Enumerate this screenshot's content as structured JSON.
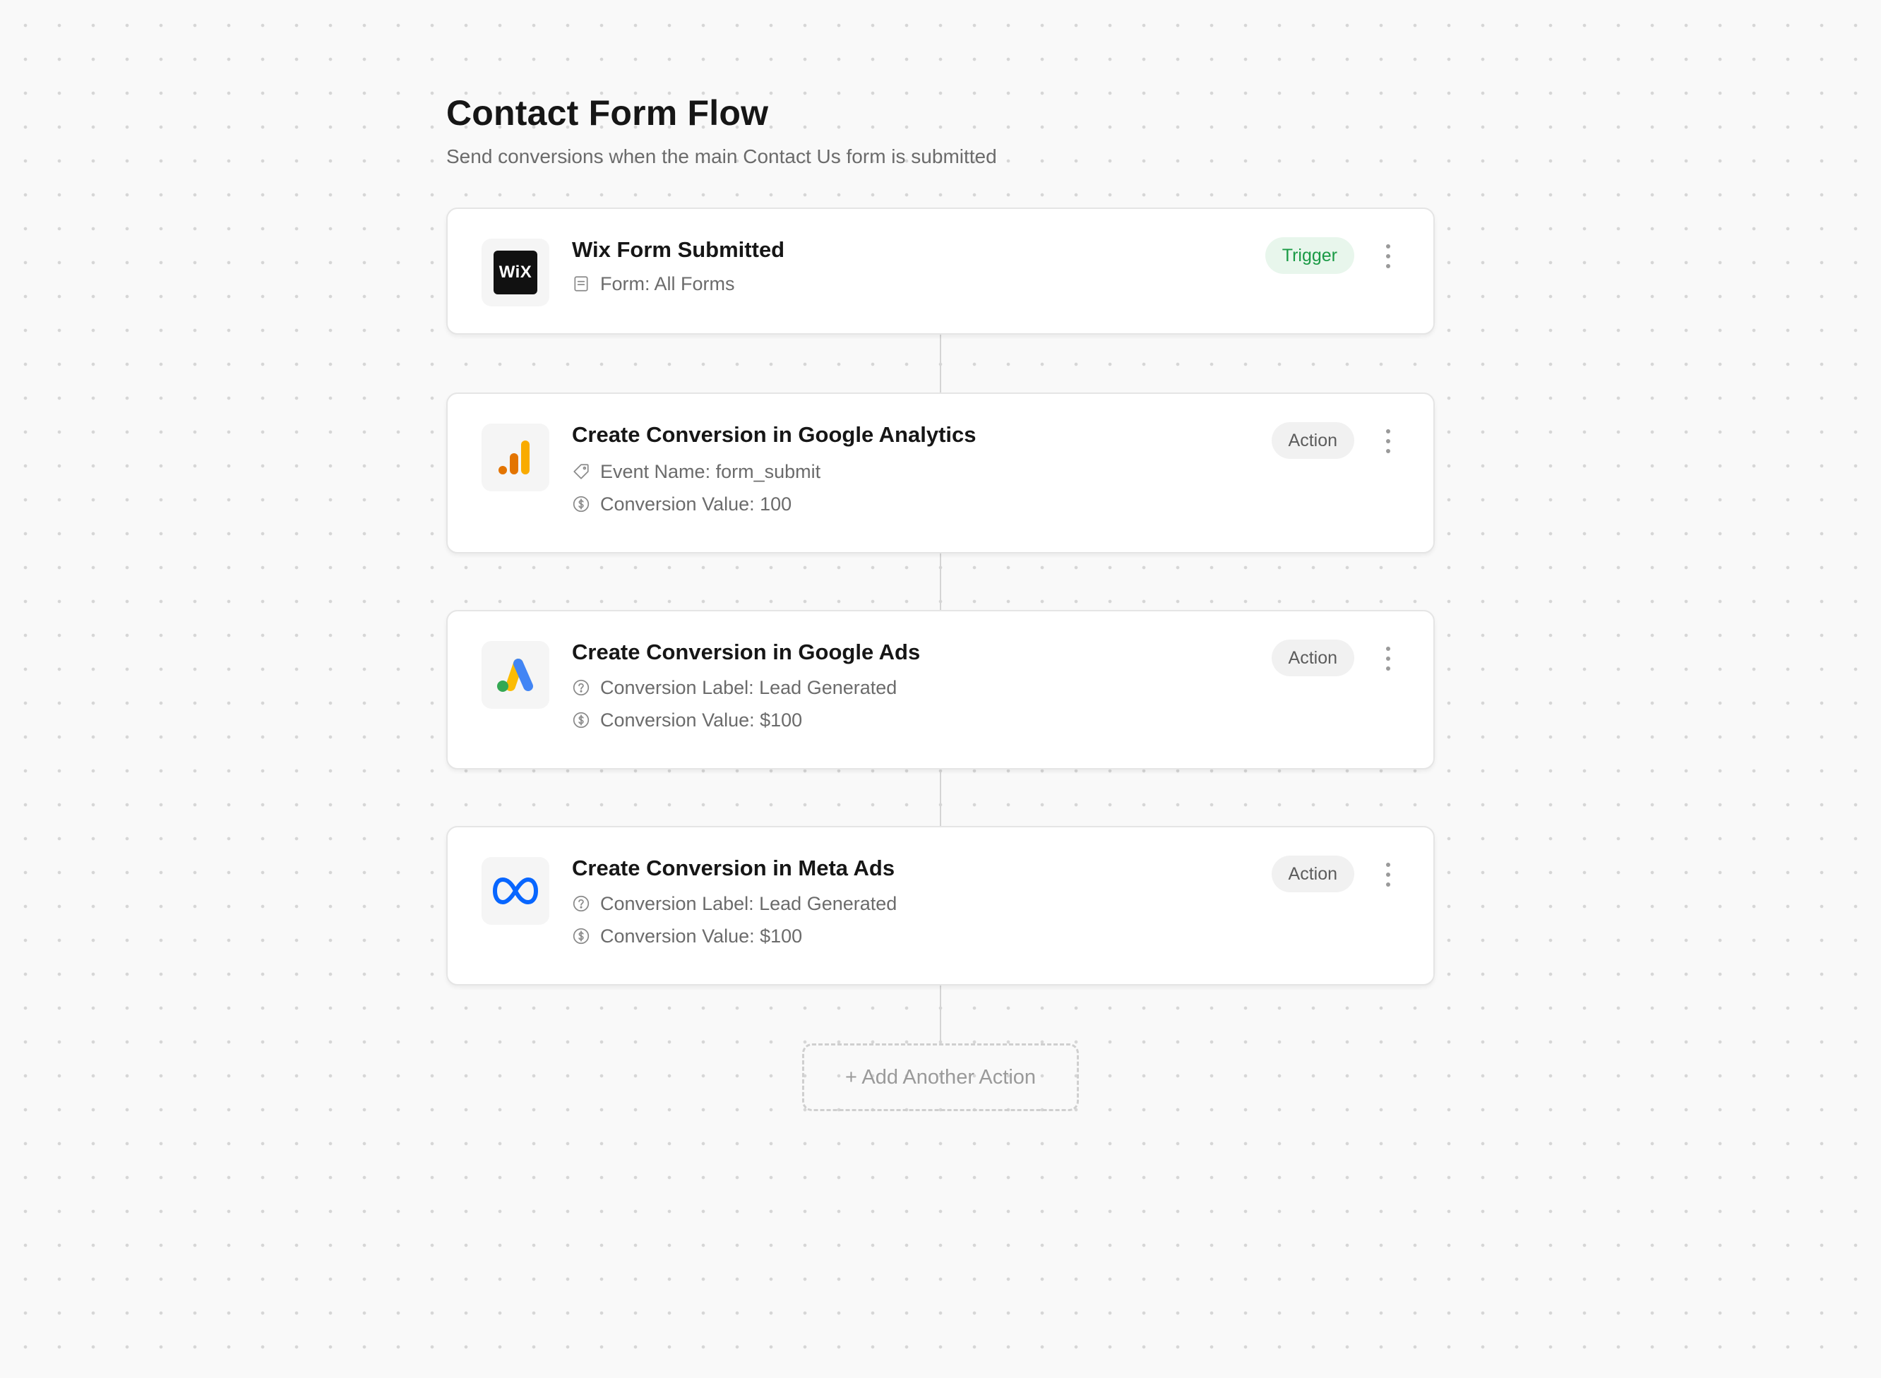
{
  "header": {
    "title": "Contact Form Flow",
    "subtitle": "Send conversions when the main Contact Us form is submitted"
  },
  "steps": [
    {
      "title": "Wix Form Submitted",
      "badge": "Trigger",
      "icon": "wix-logo-icon",
      "logo_text": "WiX",
      "details": [
        {
          "icon": "form-icon",
          "text": "Form: All Forms"
        }
      ]
    },
    {
      "title": "Create Conversion in Google Analytics",
      "badge": "Action",
      "icon": "google-analytics-logo-icon",
      "details": [
        {
          "icon": "tag-icon",
          "text": "Event Name: form_submit"
        },
        {
          "icon": "dollar-circle-icon",
          "text": "Conversion Value: 100"
        }
      ]
    },
    {
      "title": "Create Conversion in Google Ads",
      "badge": "Action",
      "icon": "google-ads-logo-icon",
      "details": [
        {
          "icon": "question-circle-icon",
          "text": "Conversion Label: Lead Generated"
        },
        {
          "icon": "dollar-circle-icon",
          "text": "Conversion Value: $100"
        }
      ]
    },
    {
      "title": "Create Conversion in Meta Ads",
      "badge": "Action",
      "icon": "meta-logo-icon",
      "details": [
        {
          "icon": "question-circle-icon",
          "text": "Conversion Label: Lead Generated"
        },
        {
          "icon": "dollar-circle-icon",
          "text": "Conversion Value: $100"
        }
      ]
    }
  ],
  "add_action_label": "+ Add Another Action",
  "colors": {
    "trigger_badge_bg": "#e8f6ec",
    "trigger_badge_text": "#1a9a45",
    "action_badge_bg": "#f1f1f1",
    "action_badge_text": "#5c5c5c",
    "ga_orange_dark": "#e37400",
    "ga_orange_light": "#f9ab00",
    "ads_blue": "#4285f4",
    "ads_yellow": "#fbbc04",
    "ads_green": "#34a853",
    "meta_blue": "#0866ff"
  }
}
